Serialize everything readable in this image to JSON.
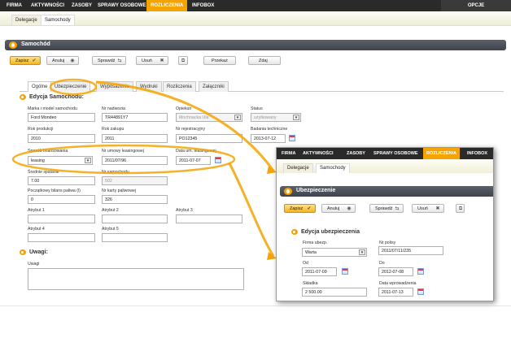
{
  "menu": {
    "items": [
      "FIRMA",
      "AKTYWNOŚCI",
      "ZASOBY",
      "SPRAWY OSOBOWE",
      "ROZLICZENIA",
      "INFOBOX"
    ],
    "options": "OPCJE"
  },
  "subnav": {
    "items": [
      "Delegacje",
      "Samochody"
    ]
  },
  "section": {
    "title": "Samochód"
  },
  "toolbar": {
    "save": "Zapisz",
    "cancel": "Anuluj",
    "check": "Sprawdź",
    "delete": "Usuń",
    "transfer": "Przekaż",
    "return": "Zdaj"
  },
  "tabs": [
    "Ogólne",
    "Ubezpieczenie",
    "Wyposażenie",
    "Wydruki",
    "Rozliczenia",
    "Załączniki"
  ],
  "edit": {
    "title": "Edycja Samochodu:",
    "make_label": "Marka i model samochodu",
    "make_value": "Ford Mondeo",
    "vin_label": "Nr nadwozia",
    "vin_value": "TR44891Y7",
    "keeper_label": "Opiekun",
    "keeper_value": "Mochnacka Ula",
    "status_label": "Status",
    "status_value": "użytkowany",
    "year_label": "Rok produkcji",
    "year_value": "2010",
    "buy_label": "Rok zakupu",
    "buy_value": "2011",
    "reg_label": "Nr rejestracyjny",
    "reg_value": "PO12345",
    "inspection_label": "Badania techniczne",
    "inspection_value": "2013-07-12",
    "finance_label": "Sposób finansowania",
    "finance_value": "leasing",
    "lease_no_label": "Nr umowy leasingowej",
    "lease_no_value": "2011/07/96",
    "lease_date_label": "Data um. leasingowej",
    "lease_date_value": "2011-07-07",
    "avg_label": "Średnie spalanie",
    "avg_value": "7.00",
    "car_no_label": "Nr samochodu",
    "car_no_value": "502",
    "fuel_init_label": "Początkowy bilans paliwa (l)",
    "fuel_init_value": "0",
    "fuel_card_label": "Nr karty paliwowej",
    "fuel_card_value": "326",
    "attr1": "Atrybut 1",
    "attr2": "Atrybut 2",
    "attr3": "Atrybut 3",
    "attr4": "Atrybut 4",
    "attr5": "Atrybut 5",
    "notes_title": "Uwagi:",
    "notes_label": "Uwagi"
  },
  "popup": {
    "menu": [
      "FIRMA",
      "AKTYWNOŚCI",
      "ZASOBY",
      "SPRAWY OSOBOWE",
      "ROZLICZENIA",
      "INFOBOX"
    ],
    "subnav": [
      "Delegacje",
      "Samochody"
    ],
    "section_title": "Ubezpieczenie",
    "save": "Zapisz",
    "cancel": "Anuluj",
    "check": "Sprawdź",
    "delete": "Usuń",
    "edit_title": "Edycja ubezpieczenia",
    "insurer_label": "Firma ubezp.",
    "insurer_value": "Warta",
    "policy_label": "Nr polisy",
    "policy_value": "2011/07/11/235",
    "from_label": "Od",
    "from_value": "2011-07-09",
    "to_label": "Do",
    "to_value": "2012-07-08",
    "premium_label": "Składka",
    "premium_value": "2 500.00",
    "entry_label": "Data wprowadzenia",
    "entry_value": "2011-07-13"
  },
  "colors": {
    "accent": "#f5a300",
    "dark": "#2a2a2a",
    "header": "#4a4f58"
  }
}
